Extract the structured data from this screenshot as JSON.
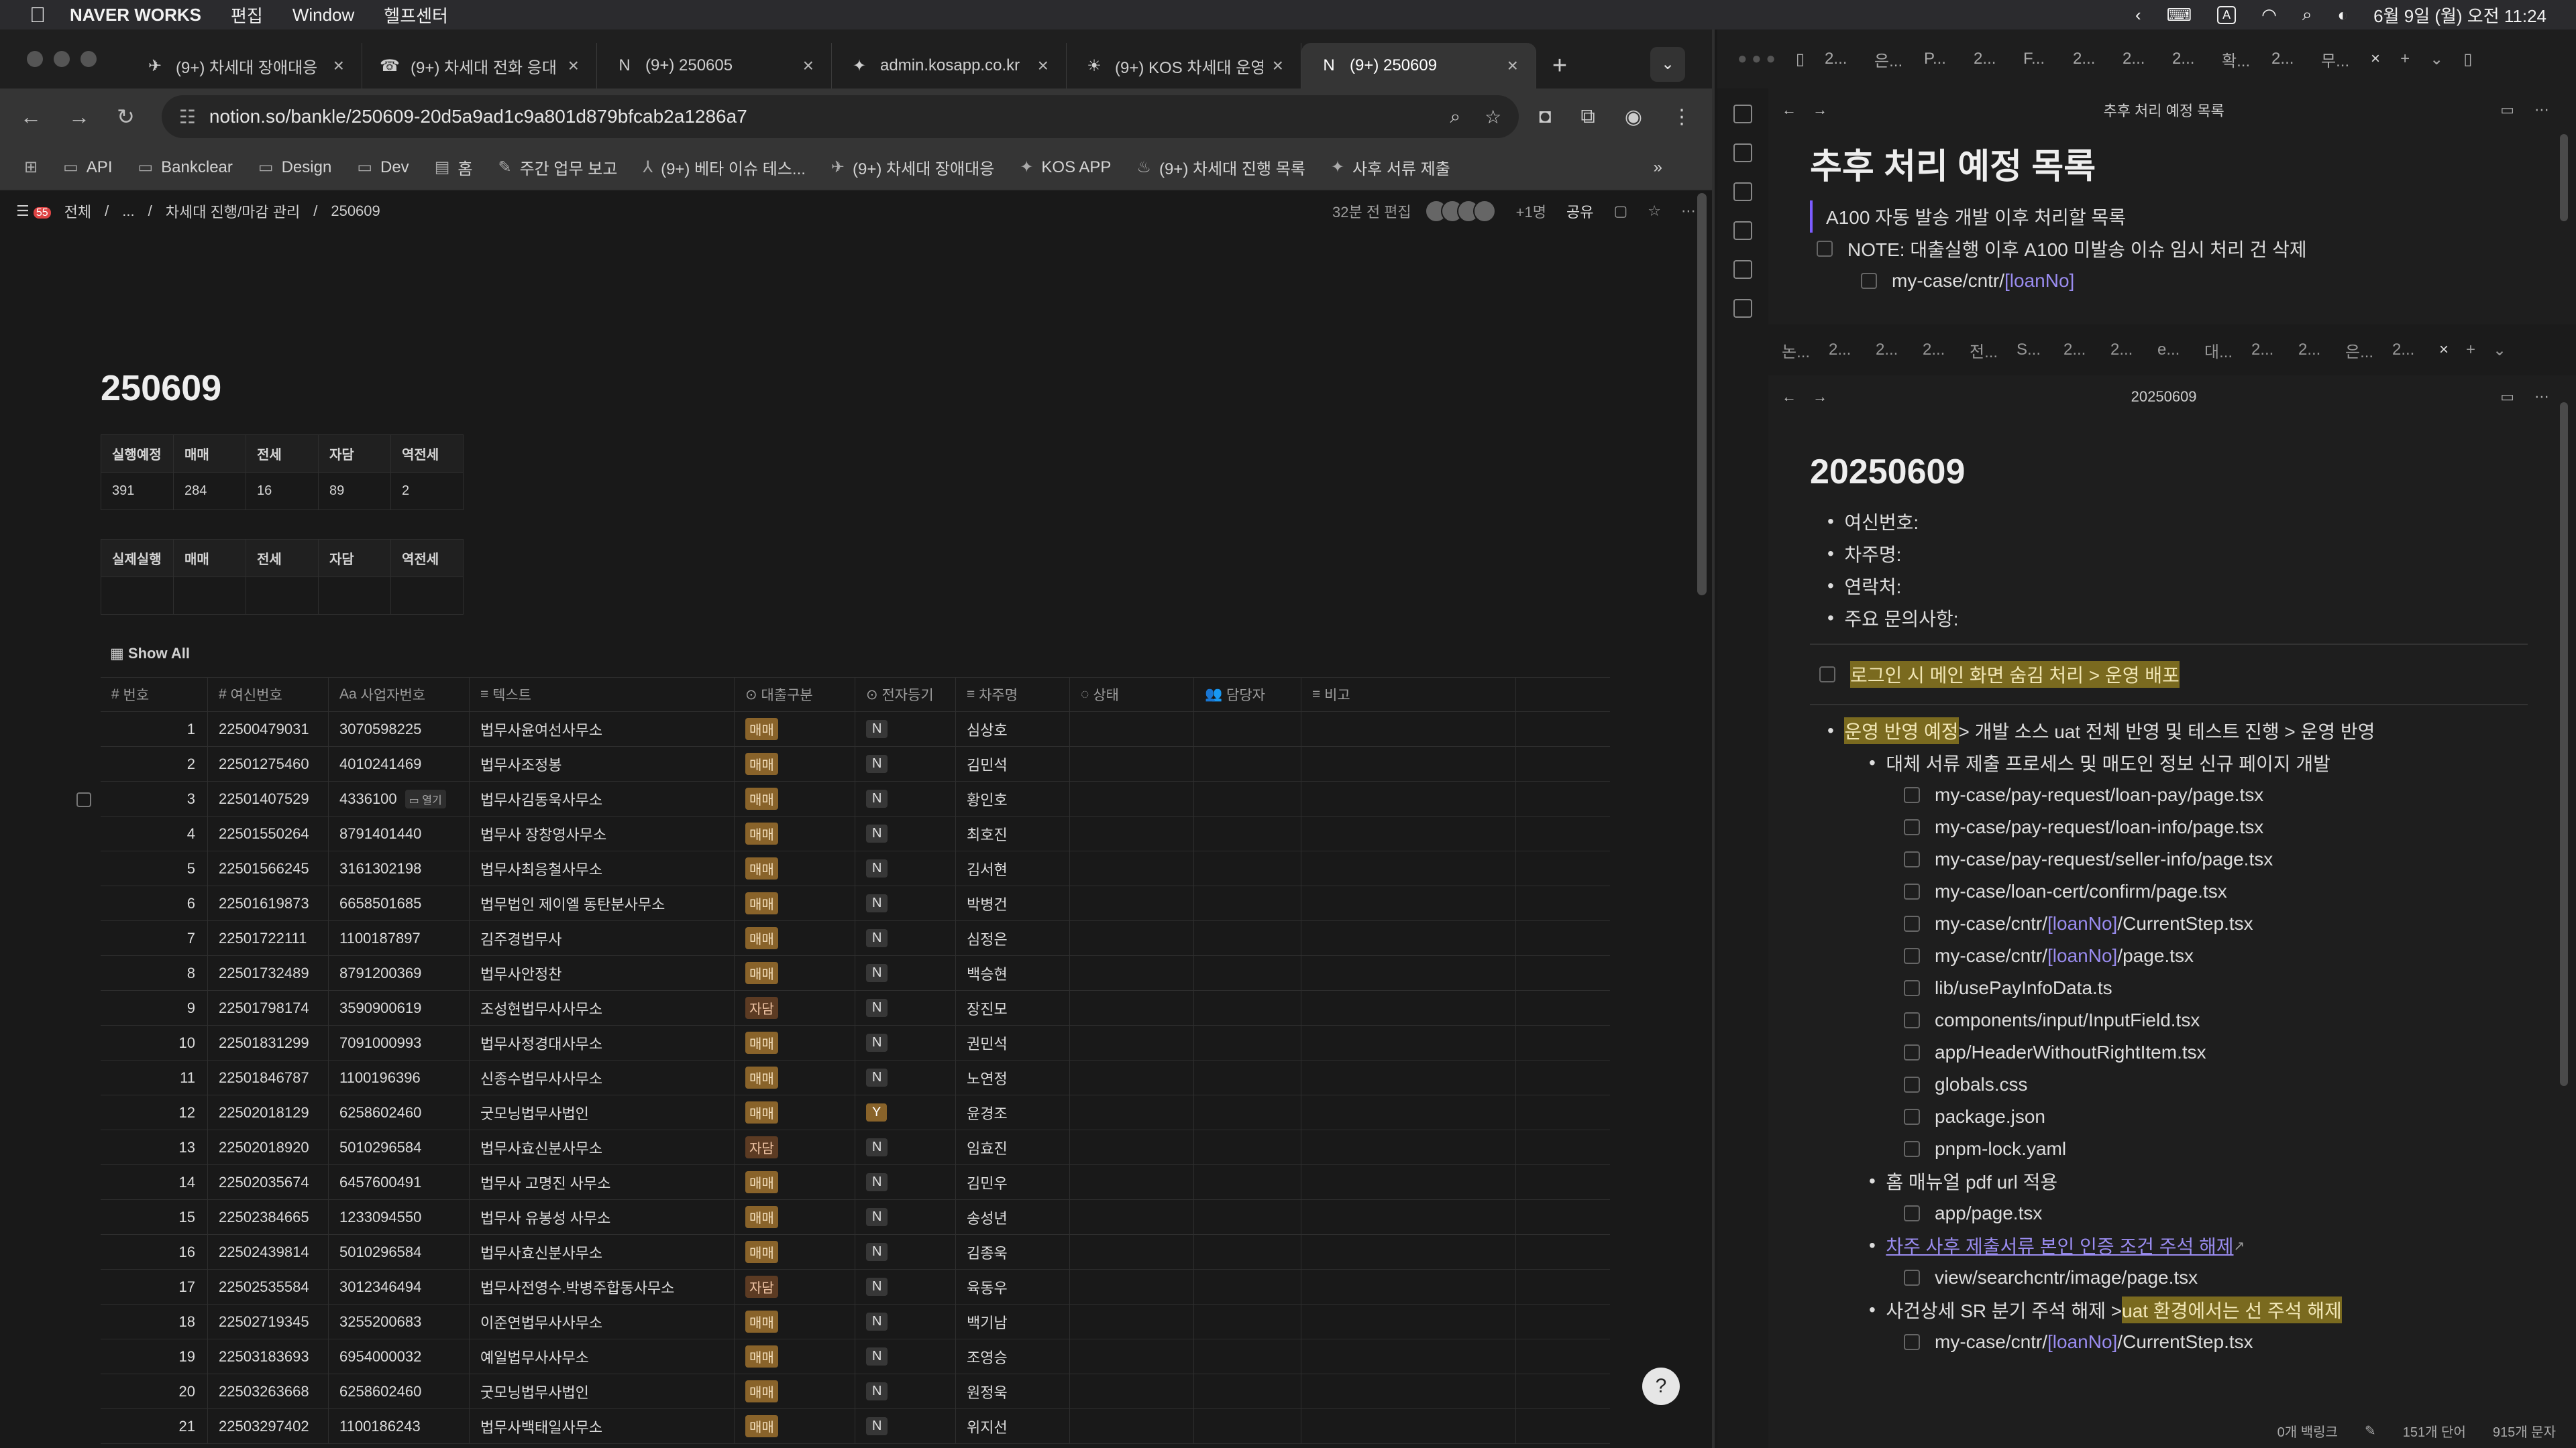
{
  "menubar": {
    "app": "NAVER WORKS",
    "items": [
      "편집",
      "Window",
      "헬프센터"
    ],
    "datetime": "6월 9일 (월) 오전 11:24",
    "input_badge": "A"
  },
  "browser": {
    "tabs": [
      {
        "icon": "✈",
        "title": "(9+) 차세대 장애대응"
      },
      {
        "icon": "☎",
        "title": "(9+) 차세대 전화 응대"
      },
      {
        "icon": "N",
        "title": "(9+) 250605"
      },
      {
        "icon": "✦",
        "title": "admin.kosapp.co.kr"
      },
      {
        "icon": "☀",
        "title": "(9+) KOS 차세대 운영"
      },
      {
        "icon": "N",
        "title": "(9+) 250609"
      }
    ],
    "url": "notion.so/bankle/250609-20d5a9ad1c9a801d879bfcab2a1286a7",
    "bookmarks": [
      "API",
      "Bankclear",
      "Design",
      "Dev",
      "홈",
      "주간 업무 보고",
      "(9+) 베타 이슈 테스...",
      "(9+) 차세대 장애대응",
      "KOS APP",
      "(9+) 차세대 진행 목록",
      "사후 서류 제출"
    ]
  },
  "notion": {
    "breadcrumb": [
      "전체",
      "...",
      "차세대 진행/마감 관리",
      "250609"
    ],
    "badge": "55",
    "edited": "32분 전 편집",
    "plus": "+1명",
    "share": "공유",
    "title": "250609",
    "summary1": {
      "headers": [
        "실행예정",
        "매매",
        "전세",
        "자담",
        "역전세"
      ],
      "values": [
        "391",
        "284",
        "16",
        "89",
        "2"
      ]
    },
    "summary2": {
      "headers": [
        "실제실행",
        "매매",
        "전세",
        "자담",
        "역전세"
      ],
      "values": [
        "",
        "",
        "",
        "",
        ""
      ]
    },
    "show_all": "Show All",
    "columns": [
      "번호",
      "여신번호",
      "사업자번호",
      "텍스트",
      "대출구분",
      "전자등기",
      "차주명",
      "상태",
      "담당자",
      "비고"
    ],
    "open_label": "열기",
    "rows": [
      [
        "1",
        "22500479031",
        "3070598225",
        "법무사윤여선사무소",
        "매매",
        "N",
        "심상호"
      ],
      [
        "2",
        "22501275460",
        "4010241469",
        "법무사조정봉",
        "매매",
        "N",
        "김민석"
      ],
      [
        "3",
        "22501407529",
        "4336100",
        "법무사김동욱사무소",
        "매매",
        "N",
        "황인호"
      ],
      [
        "4",
        "22501550264",
        "8791401440",
        "법무사 장창영사무소",
        "매매",
        "N",
        "최호진"
      ],
      [
        "5",
        "22501566245",
        "3161302198",
        "법무사최응철사무소",
        "매매",
        "N",
        "김서현"
      ],
      [
        "6",
        "22501619873",
        "6658501685",
        "법무법인 제이엘 동탄분사무소",
        "매매",
        "N",
        "박병건"
      ],
      [
        "7",
        "22501722111",
        "1100187897",
        "김주경법무사",
        "매매",
        "N",
        "심정은"
      ],
      [
        "8",
        "22501732489",
        "8791200369",
        "법무사안정찬",
        "매매",
        "N",
        "백승현"
      ],
      [
        "9",
        "22501798174",
        "3590900619",
        "조성현법무사사무소",
        "자담",
        "N",
        "장진모"
      ],
      [
        "10",
        "22501831299",
        "7091000993",
        "법무사정경대사무소",
        "매매",
        "N",
        "권민석"
      ],
      [
        "11",
        "22501846787",
        "1100196396",
        "신종수법무사사무소",
        "매매",
        "N",
        "노연정"
      ],
      [
        "12",
        "22502018129",
        "6258602460",
        "굿모닝법무사법인",
        "매매",
        "Y",
        "윤경조"
      ],
      [
        "13",
        "22502018920",
        "5010296584",
        "법무사효신분사무소",
        "자담",
        "N",
        "임효진"
      ],
      [
        "14",
        "22502035674",
        "6457600491",
        "법무사 고명진 사무소",
        "매매",
        "N",
        "김민우"
      ],
      [
        "15",
        "22502384665",
        "1233094550",
        "법무사 유봉성 사무소",
        "매매",
        "N",
        "송성년"
      ],
      [
        "16",
        "22502439814",
        "5010296584",
        "법무사효신분사무소",
        "매매",
        "N",
        "김종욱"
      ],
      [
        "17",
        "22502535584",
        "3012346494",
        "법무사전영수.박병주합동사무소",
        "자담",
        "N",
        "육동우"
      ],
      [
        "18",
        "22502719345",
        "3255200683",
        "이준연법무사사무소",
        "매매",
        "N",
        "백기남"
      ],
      [
        "19",
        "22503183693",
        "6954000032",
        "예일법무사사무소",
        "매매",
        "N",
        "조영승"
      ],
      [
        "20",
        "22503263668",
        "6258602460",
        "굿모닝법무사법인",
        "매매",
        "N",
        "원정욱"
      ],
      [
        "21",
        "22503297402",
        "1100186243",
        "법무사백태일사무소",
        "매매",
        "N",
        "위지선"
      ]
    ]
  },
  "obsidian": {
    "top_tabs": [
      "2...",
      "은...",
      "P...",
      "2...",
      "F...",
      "2...",
      "2...",
      "2...",
      "확...",
      "2...",
      "무..."
    ],
    "pane1": {
      "header": "추후 처리 예정 목록",
      "title": "추후 처리 예정 목록",
      "line1": "A100 자동 발송 개발 이후 처리할 목록",
      "note": "NOTE: 대출실행 이후 A100 미발송 이슈 임시 처리 건 삭제",
      "path_prefix": "my-case/cntr/",
      "path_link": "[loanNo]"
    },
    "pane2_tabs": [
      "논...",
      "2...",
      "2...",
      "2...",
      "전...",
      "S...",
      "2...",
      "2...",
      "e...",
      "대...",
      "2...",
      "2...",
      "은...",
      "2..."
    ],
    "pane2": {
      "header": "20250609",
      "title": "20250609",
      "fields": [
        "여신번호:",
        "차주명:",
        "연락처:",
        "주요 문의사항:"
      ],
      "todo1": "로그인 시 메인 화면 숨김 처리 > 운영 배포",
      "sec_hl": "운영 반영 예정",
      "sec_rest": " > 개발 소스 uat 전체 반영 및 테스트 진행 > 운영 반영",
      "sub1": "대체 서류 제출 프로세스 및 매도인 정보 신규 페이지 개발",
      "files1": [
        "my-case/pay-request/loan-pay/page.tsx",
        "my-case/pay-request/loan-info/page.tsx",
        "my-case/pay-request/seller-info/page.tsx",
        "my-case/loan-cert/confirm/page.tsx"
      ],
      "f_cntr1_a": "my-case/cntr/",
      "f_cntr1_b": "[loanNo]",
      "f_cntr1_c": "/CurrentStep.tsx",
      "f_cntr2_a": "my-case/cntr/",
      "f_cntr2_b": "[loanNo]",
      "f_cntr2_c": "/page.tsx",
      "files2": [
        "lib/usePayInfoData.ts",
        "components/input/InputField.tsx",
        "app/HeaderWithoutRightItem.tsx",
        "globals.css",
        "package.json",
        "pnpm-lock.yaml"
      ],
      "sub2": "홈 매뉴얼 pdf url 적용",
      "sub2_file": "app/page.tsx",
      "sub3": "차주 사후 제출서류 본인 인증 조건 주석 해제",
      "sub3_file": "view/searchcntr/image/page.tsx",
      "sub4_a": "사건상세 SR 분기 주석 해제 > ",
      "sub4_hl": "uat 환경에서는 선 주석 해제",
      "f_last_a": "my-case/cntr/",
      "f_last_b": "[loanNo]",
      "f_last_c": "/CurrentStep.tsx"
    },
    "status": {
      "backlinks": "0개 백링크",
      "words": "151개 단어",
      "chars": "915개 문자"
    }
  }
}
